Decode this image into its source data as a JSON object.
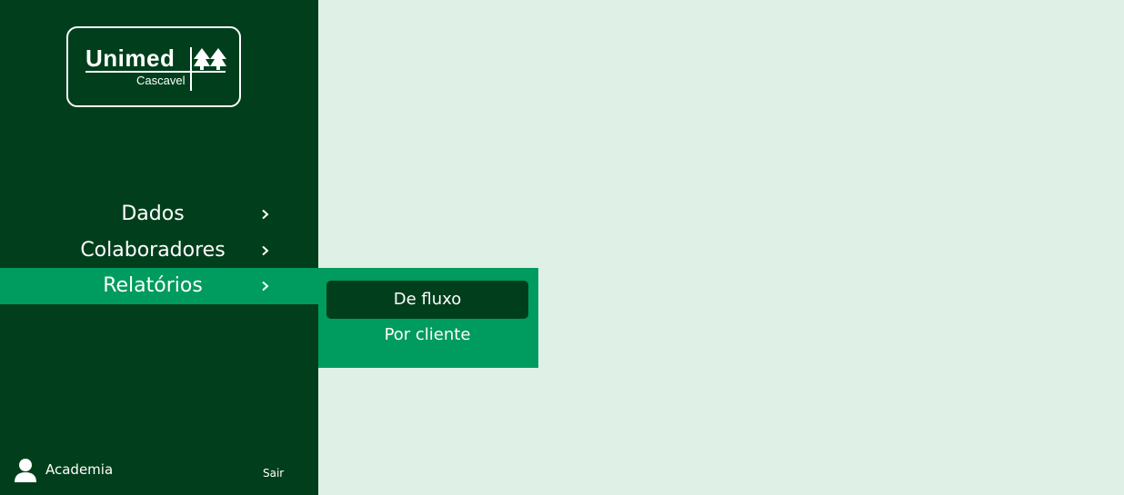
{
  "brand": {
    "name": "Unimed",
    "subtitle": "Cascavel"
  },
  "menu": {
    "items": [
      {
        "label": "Dados",
        "icon": "chevron-right-icon"
      },
      {
        "label": "Colaboradores",
        "icon": "chevron-right-icon"
      },
      {
        "label": "Relatórios",
        "icon": "chevron-right-icon",
        "active": true
      }
    ]
  },
  "submenu": {
    "items": [
      {
        "label": "De fluxo",
        "selected": true
      },
      {
        "label": "Por cliente"
      }
    ]
  },
  "user": {
    "name": "Academia",
    "icon": "user-icon",
    "logout_label": "Sair"
  },
  "colors": {
    "sidebar": "#013f1c",
    "accent": "#009b5e",
    "content_bg": "#dff0e7"
  }
}
